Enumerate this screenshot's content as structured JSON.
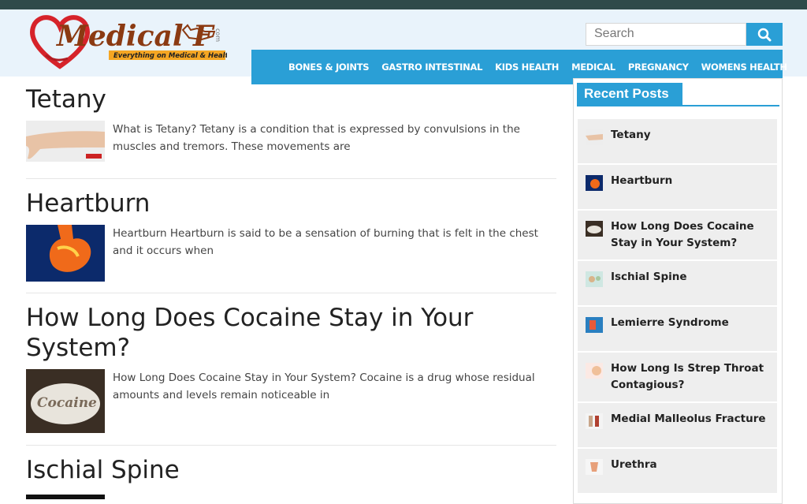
{
  "header": {
    "logo_text": "Medical F",
    "logo_tagline": "Everything on Medical & Health",
    "logo_com": "com",
    "search_placeholder": "Search"
  },
  "nav": {
    "items": [
      "BONES & JOINTS",
      "GASTRO INTESTINAL",
      "KIDS HEALTH",
      "MEDICAL",
      "PREGNANCY",
      "WOMENS HEALTH"
    ]
  },
  "posts": [
    {
      "title": "Tetany",
      "excerpt": "What is Tetany? Tetany is a condition that is expressed by convulsions in the muscles and tremors. These movements are"
    },
    {
      "title": "Heartburn",
      "excerpt": "Heartburn Heartburn is said to be a sensation of burning that is felt in the chest and it occurs when"
    },
    {
      "title": "How Long Does Cocaine Stay in Your System?",
      "excerpt": "How Long Does Cocaine Stay in Your System? Cocaine is a drug whose residual amounts and levels remain noticeable in"
    },
    {
      "title": "Ischial Spine",
      "excerpt": ""
    }
  ],
  "sidebar": {
    "title": "Recent Posts",
    "items": [
      "Tetany",
      "Heartburn",
      "How Long Does Cocaine Stay in Your System?",
      "Ischial Spine",
      "Lemierre Syndrome",
      "How Long Is Strep Throat Contagious?",
      "Medial Malleolus Fracture",
      "Urethra"
    ]
  },
  "colors": {
    "accent": "#2a9fd6",
    "topbar": "#2f4a4a",
    "header_bg": "#e9f3fb",
    "logo_brown": "#8b3a12",
    "logo_red": "#d6232a"
  }
}
